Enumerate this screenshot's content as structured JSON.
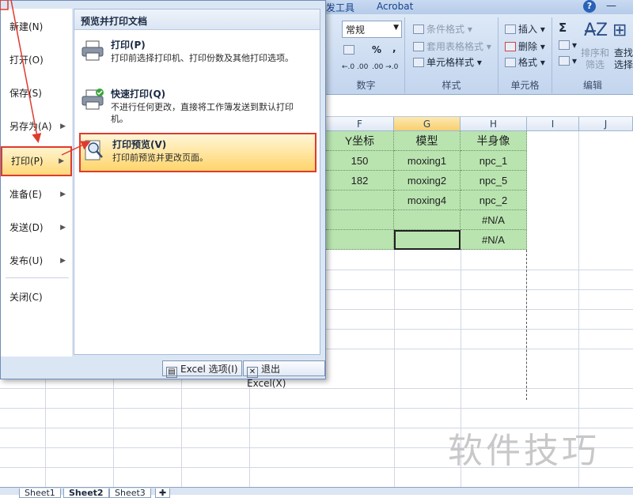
{
  "ribbon": {
    "tabs": [
      "发工具",
      "Acrobat"
    ],
    "help_glyph": "?",
    "window_min": "—",
    "number": {
      "format_value": "常规",
      "percent": "%",
      "comma": ",",
      "dec_inc": "←.0 .00",
      "dec_dec": ".00 →.0",
      "label": "数字"
    },
    "styles": {
      "conditional": "条件格式",
      "table_format": "套用表格格式",
      "cell_styles": "单元格样式",
      "label": "样式"
    },
    "cells": {
      "insert": "插入",
      "delete": "删除",
      "format": "格式",
      "label": "单元格"
    },
    "editing": {
      "sum": "Σ",
      "sort_filter": "排序和\n筛选",
      "find_select": "查找\n选择",
      "label": "编辑"
    }
  },
  "sheet": {
    "columns": [
      "F",
      "G",
      "H",
      "I",
      "J"
    ],
    "header_row": [
      "Y坐标",
      "模型",
      "半身像"
    ],
    "rows": [
      [
        "150",
        "moxing1",
        "npc_1"
      ],
      [
        "182",
        "moxing2",
        "npc_5"
      ],
      [
        "",
        "moxing4",
        "npc_2"
      ],
      [
        "",
        "",
        "#N/A"
      ],
      [
        "",
        "",
        "#N/A"
      ]
    ],
    "tabs": [
      "Sheet1",
      "Sheet2",
      "Sheet3"
    ]
  },
  "menu": {
    "left_items": [
      {
        "label": "新建(N)",
        "arrow": false
      },
      {
        "label": "打开(O)",
        "arrow": false
      },
      {
        "label": "保存(S)",
        "arrow": false
      },
      {
        "label": "另存为(A)",
        "arrow": true
      },
      {
        "label": "打印(P)",
        "arrow": true
      },
      {
        "label": "准备(E)",
        "arrow": true
      },
      {
        "label": "发送(D)",
        "arrow": true
      },
      {
        "label": "发布(U)",
        "arrow": true
      },
      {
        "label": "关闭(C)",
        "arrow": false
      }
    ],
    "submenu_title": "预览并打印文档",
    "submenu_items": [
      {
        "title": "打印(P)",
        "desc": "打印前选择打印机、打印份数及其他打印选项。"
      },
      {
        "title": "快速打印(Q)",
        "desc": "不进行任何更改，直接将工作簿发送到默认打印机。"
      },
      {
        "title": "打印预览(V)",
        "desc": "打印前预览并更改页面。"
      }
    ],
    "options_button": "Excel 选项(I)",
    "exit_button": "退出 Excel(X)"
  },
  "watermark": "软件技巧",
  "colors": {
    "highlight_red": "#e03a2e",
    "green_fill": "#b9e4b0",
    "selected_col": "#f8cf6f"
  }
}
